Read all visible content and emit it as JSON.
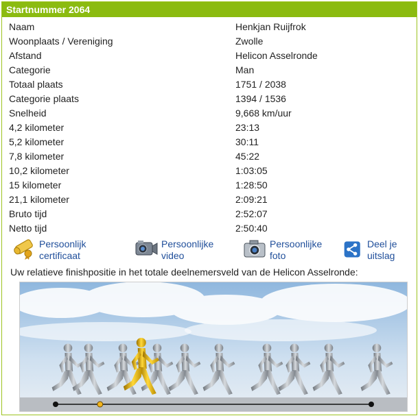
{
  "header": {
    "title": "Startnummer 2064"
  },
  "rows": [
    {
      "label": "Naam",
      "value": "Henkjan Ruijfrok"
    },
    {
      "label": "Woonplaats / Vereniging",
      "value": "Zwolle"
    },
    {
      "label": "Afstand",
      "value": "Helicon Asselronde"
    },
    {
      "label": "Categorie",
      "value": "Man"
    },
    {
      "label": "Totaal plaats",
      "value": "1751 / 2038"
    },
    {
      "label": "Categorie plaats",
      "value": "1394 / 1536"
    },
    {
      "label": "Snelheid",
      "value": "9,668 km/uur"
    },
    {
      "label": "4,2 kilometer",
      "value": "23:13"
    },
    {
      "label": "5,2 kilometer",
      "value": "30:11"
    },
    {
      "label": "7,8 kilometer",
      "value": "45:22"
    },
    {
      "label": "10,2 kilometer",
      "value": "1:03:05"
    },
    {
      "label": "15 kilometer",
      "value": "1:28:50"
    },
    {
      "label": "21,1 kilometer",
      "value": "2:09:21"
    },
    {
      "label": "Bruto tijd",
      "value": "2:52:07"
    },
    {
      "label": "Netto tijd",
      "value": "2:50:40"
    }
  ],
  "links": [
    {
      "line1": "Persoonlijk",
      "line2": "certificaat",
      "icon": "certificate-icon"
    },
    {
      "line1": "Persoonlijke",
      "line2": "video",
      "icon": "video-camera-icon"
    },
    {
      "line1": "Persoonlijke",
      "line2": "foto",
      "icon": "photo-camera-icon"
    },
    {
      "line1": "Deel je",
      "line2": "uitslag",
      "icon": "share-icon"
    }
  ],
  "finish_caption": "Uw relatieve finishpositie in het totale deelnemersveld van de Helicon Asselronde:",
  "finish_position": {
    "place": 1751,
    "total": 2038
  },
  "colors": {
    "header": "#8bbb10",
    "link": "#1f4e9a",
    "highlight_runner": "#e0b000"
  }
}
